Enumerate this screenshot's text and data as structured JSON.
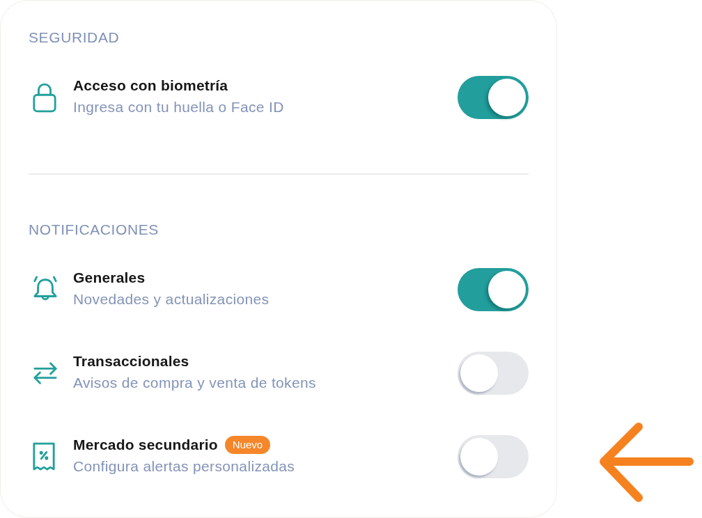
{
  "sections": [
    {
      "heading": "SEGURIDAD",
      "items": [
        {
          "title": "Acceso con biometría",
          "subtitle": "Ingresa con tu huella o Face ID",
          "on": true
        }
      ]
    },
    {
      "heading": "NOTIFICACIONES",
      "items": [
        {
          "title": "Generales",
          "subtitle": "Novedades y actualizaciones",
          "on": true
        },
        {
          "title": "Transaccionales",
          "subtitle": "Avisos de compra y venta de tokens",
          "on": false
        },
        {
          "title": "Mercado secundario",
          "badge": "Nuevo",
          "subtitle": "Configura alertas personalizadas",
          "on": false
        }
      ]
    }
  ]
}
